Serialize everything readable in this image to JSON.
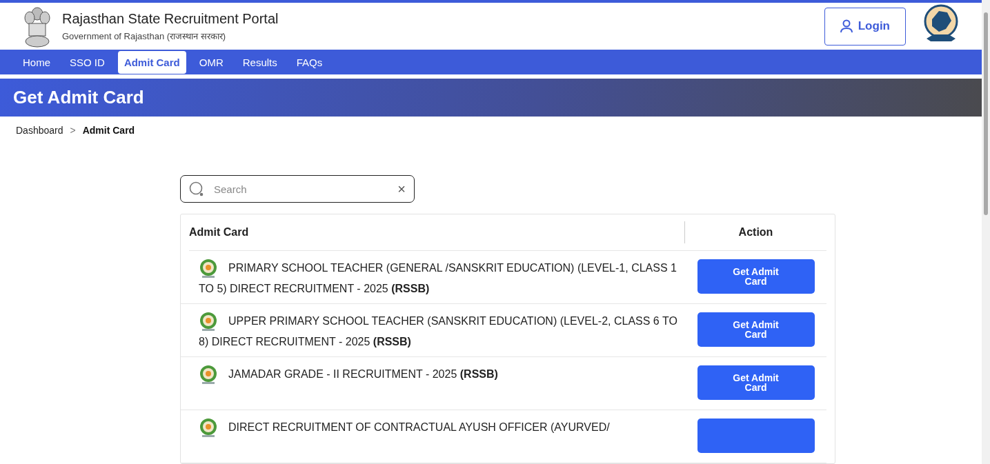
{
  "header": {
    "title": "Rajasthan State Recruitment Portal",
    "subtitle": "Government of Rajasthan (राजस्थान सरकार)",
    "login": "Login"
  },
  "nav": [
    {
      "label": "Home",
      "selected": false
    },
    {
      "label": "SSO ID",
      "selected": false
    },
    {
      "label": "Admit Card",
      "selected": true
    },
    {
      "label": "OMR",
      "selected": false
    },
    {
      "label": "Results",
      "selected": false
    },
    {
      "label": "FAQs",
      "selected": false
    }
  ],
  "banner": {
    "title": "Get Admit Card"
  },
  "breadcrumb": [
    {
      "label": "Dashboard",
      "selected": false
    },
    {
      "label": ">",
      "kind": "separator"
    },
    {
      "label": "Admit Card",
      "selected": true
    }
  ],
  "search": {
    "placeholder": "Search",
    "clear": "×"
  },
  "table": {
    "columns": [
      "Admit Card",
      "Action"
    ],
    "rows": [
      {
        "title": "PRIMARY SCHOOL TEACHER (GENERAL /SANSKRIT EDUCATION) (LEVEL-1, CLASS 1 TO 5) DIRECT RECRUITMENT - 2025 **(RSSB)**",
        "action": "Get Admit Card"
      },
      {
        "title": "UPPER PRIMARY SCHOOL TEACHER (SANSKRIT EDUCATION) (LEVEL-2, CLASS 6 TO 8) DIRECT RECRUITMENT - 2025 **(RSSB)**",
        "action": "Get Admit Card"
      },
      {
        "title": "JAMADAR GRADE - II RECRUITMENT - 2025 **(RSSB)**",
        "action": "Get Admit Card"
      },
      {
        "title": "DIRECT RECRUITMENT OF CONTRACTUAL AYUSH OFFICER (AYURVED/",
        "action": ""
      }
    ]
  }
}
